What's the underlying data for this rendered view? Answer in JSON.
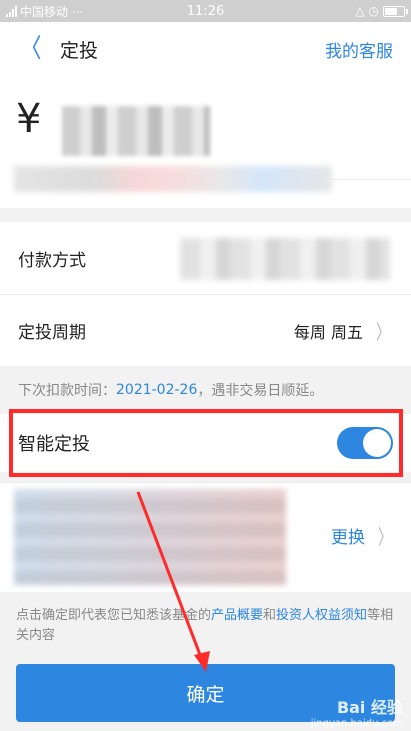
{
  "status_bar": {
    "carrier": "中国移动 ···",
    "time": "11:26"
  },
  "nav": {
    "title": "定投",
    "service_link": "我的客服"
  },
  "amount": {
    "currency_symbol": "¥"
  },
  "payment": {
    "label": "付款方式"
  },
  "period": {
    "label": "定投周期",
    "value": "每周 周五"
  },
  "hint": {
    "prefix": "下次扣款时间：",
    "date": "2021-02-26",
    "suffix": "，遇非交易日顺延。"
  },
  "smart": {
    "label": "智能定投",
    "enabled": true
  },
  "card": {
    "change_label": "更换"
  },
  "legal": {
    "prefix": "点击确定即代表您已知悉该基金的",
    "link1": "产品概要",
    "and": "和",
    "link2": "投资人权益须知",
    "suffix": "等相关内容"
  },
  "confirm": {
    "label": "确定"
  },
  "watermark": {
    "brand": "Bai 经验",
    "url": "jingyan.baidu.com"
  },
  "colors": {
    "accent": "#2d86e0",
    "annotation": "#ff2a2a"
  }
}
